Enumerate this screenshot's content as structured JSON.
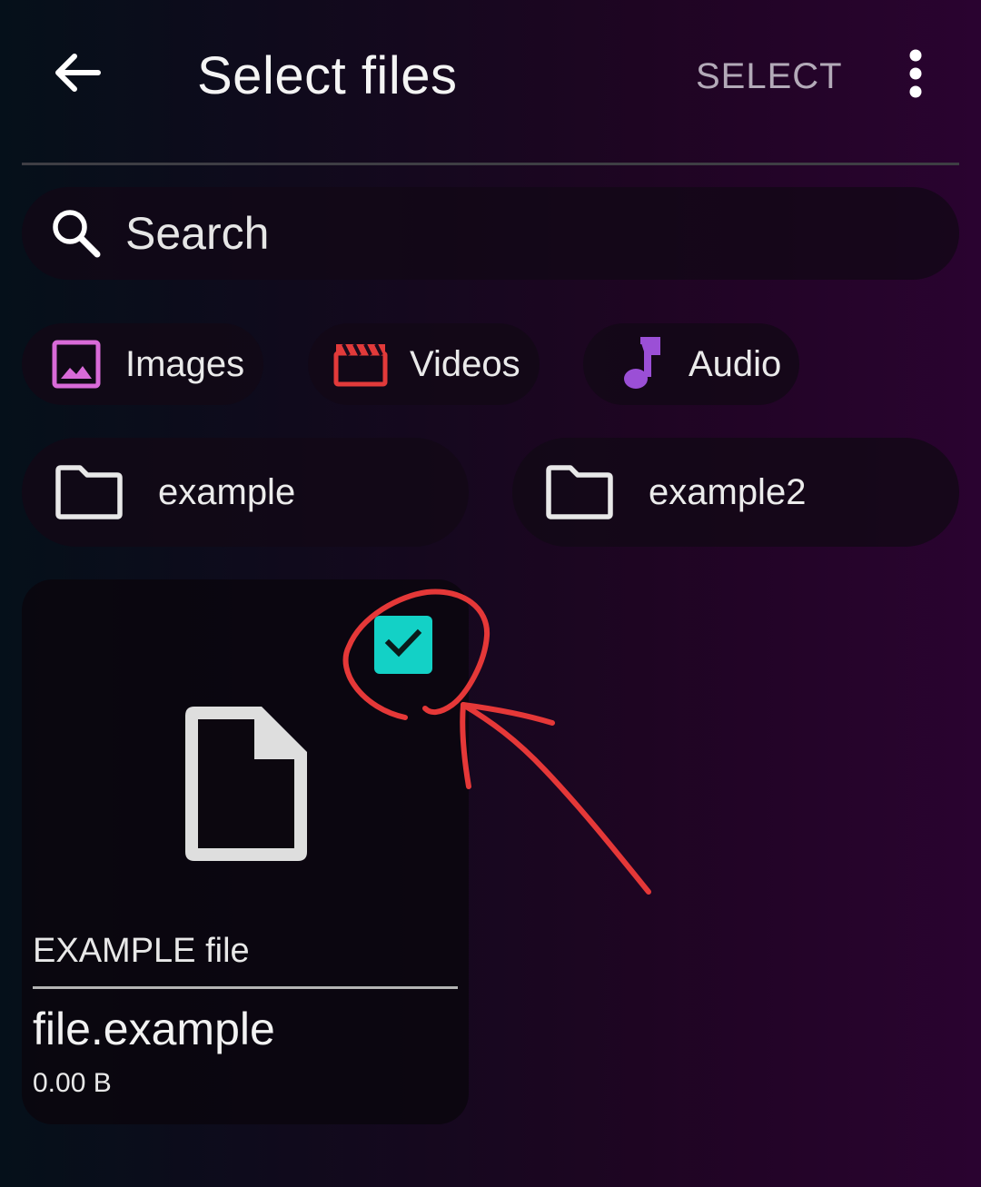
{
  "header": {
    "title": "Select files",
    "action_label": "SELECT",
    "back_icon": "arrow-left-icon",
    "more_icon": "more-vertical-icon"
  },
  "search": {
    "placeholder": "Search",
    "icon": "search-icon"
  },
  "categories": [
    {
      "label": "Images",
      "icon": "image-icon",
      "color": "#d86ad8"
    },
    {
      "label": "Videos",
      "icon": "clapperboard-icon",
      "color": "#e23a3a"
    },
    {
      "label": "Audio",
      "icon": "music-note-icon",
      "color": "#9b4fd6"
    }
  ],
  "folders": [
    {
      "label": "example",
      "icon": "folder-icon"
    },
    {
      "label": "example2",
      "icon": "folder-icon"
    }
  ],
  "files": [
    {
      "type_label": "EXAMPLE file",
      "name": "file.example",
      "size": "0.00 B",
      "selected": true,
      "icon": "file-icon",
      "checkbox_color": "#13d1c6"
    }
  ],
  "annotation": {
    "color": "#e53838",
    "shape": "circle-and-arrow"
  }
}
